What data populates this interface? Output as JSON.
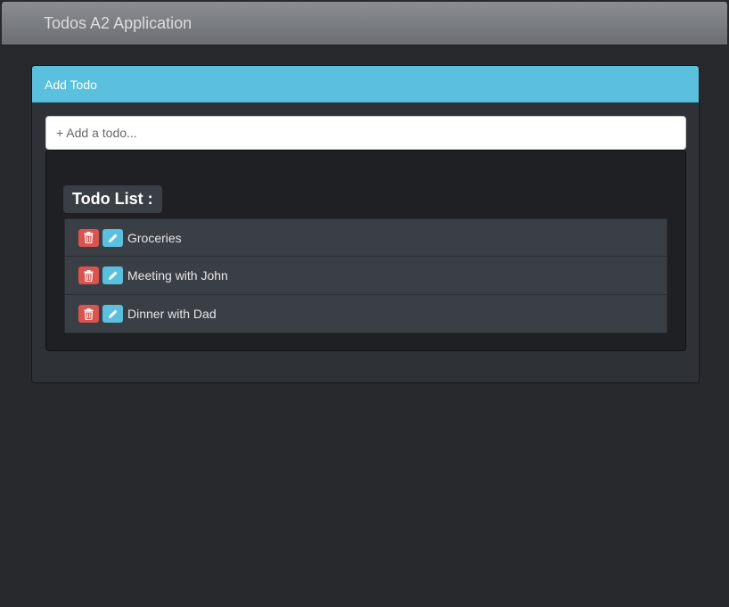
{
  "navbar": {
    "title": "Todos A2 Application"
  },
  "panel": {
    "heading": "Add Todo",
    "input": {
      "placeholder": "+ Add a todo...",
      "value": ""
    }
  },
  "list": {
    "label": "Todo List :",
    "items": [
      {
        "text": "Groceries",
        "delete_icon": "trash-icon",
        "edit_icon": "pencil-icon"
      },
      {
        "text": "Meeting with John",
        "delete_icon": "trash-icon",
        "edit_icon": "pencil-icon"
      },
      {
        "text": "Dinner with Dad",
        "delete_icon": "trash-icon",
        "edit_icon": "pencil-icon"
      }
    ]
  },
  "colors": {
    "panel_heading": "#5bc0de",
    "delete_button": "#d9534f",
    "edit_button": "#5bc0de",
    "background": "#27292d"
  }
}
